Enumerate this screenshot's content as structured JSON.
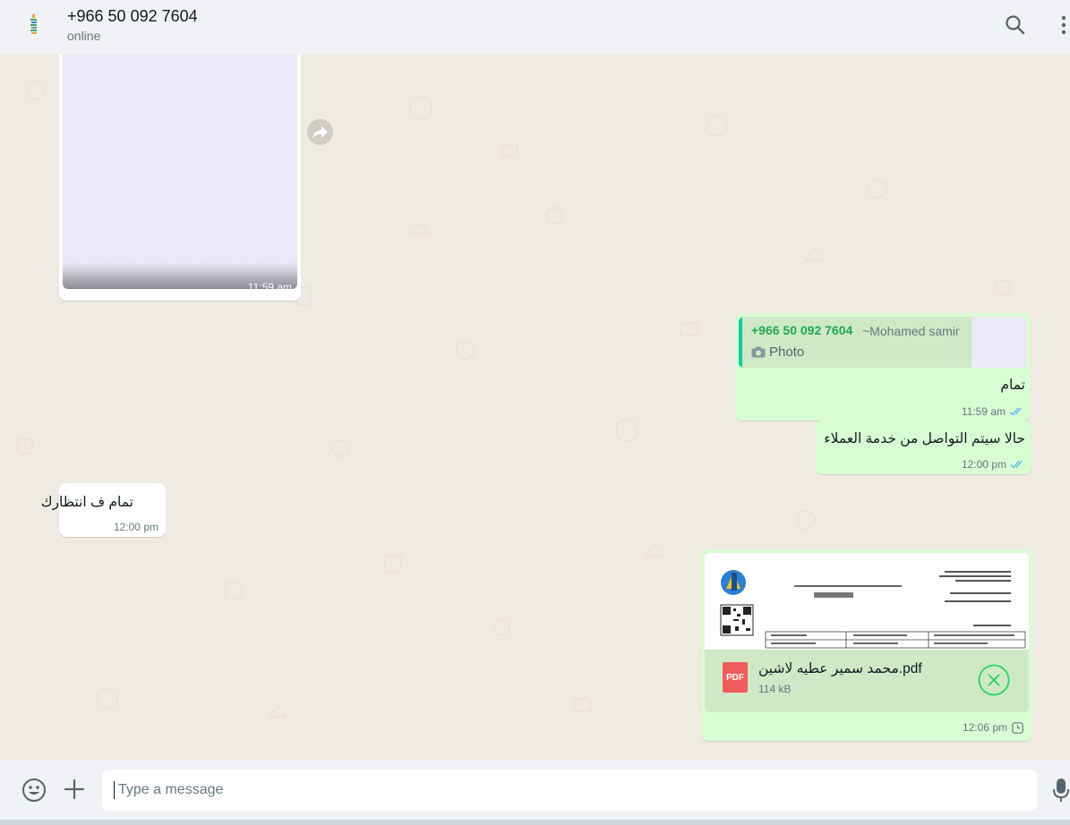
{
  "header": {
    "contact_name": "+966 50 092 7604",
    "status": "online"
  },
  "messages": {
    "media": {
      "time": "11:59 am"
    },
    "reply": {
      "quote_author": "+966 50 092 7604",
      "quote_alias": "~Mohamed samir",
      "quote_type": "Photo",
      "text": "تمام",
      "time": "11:59 am"
    },
    "out_text": {
      "text": "حالا سيتم التواصل من خدمة العملاء",
      "time": "12:00 pm"
    },
    "in_text": {
      "text": "تمام ف انتظارك",
      "time": "12:00 pm"
    },
    "document": {
      "file_name": "محمد سمير عطيه لاشين.pdf",
      "file_size": "114 kB",
      "file_type": "PDF",
      "time": "12:06 pm"
    }
  },
  "footer": {
    "placeholder": "Type a message"
  },
  "colors": {
    "chat_background": "#efeae2",
    "outgoing_bubble": "#d9fdd3",
    "incoming_bubble": "#ffffff",
    "read_ticks": "#53bdeb",
    "accent": "#1fa855"
  },
  "icons": {
    "search": "search-icon",
    "menu": "menu-icon",
    "forward": "forward-icon",
    "camera": "camera-icon",
    "ticks": "double-check-icon",
    "pending": "clock-icon",
    "cancel": "cancel-icon",
    "emoji": "emoji-icon",
    "attach": "plus-icon",
    "mic": "mic-icon"
  }
}
